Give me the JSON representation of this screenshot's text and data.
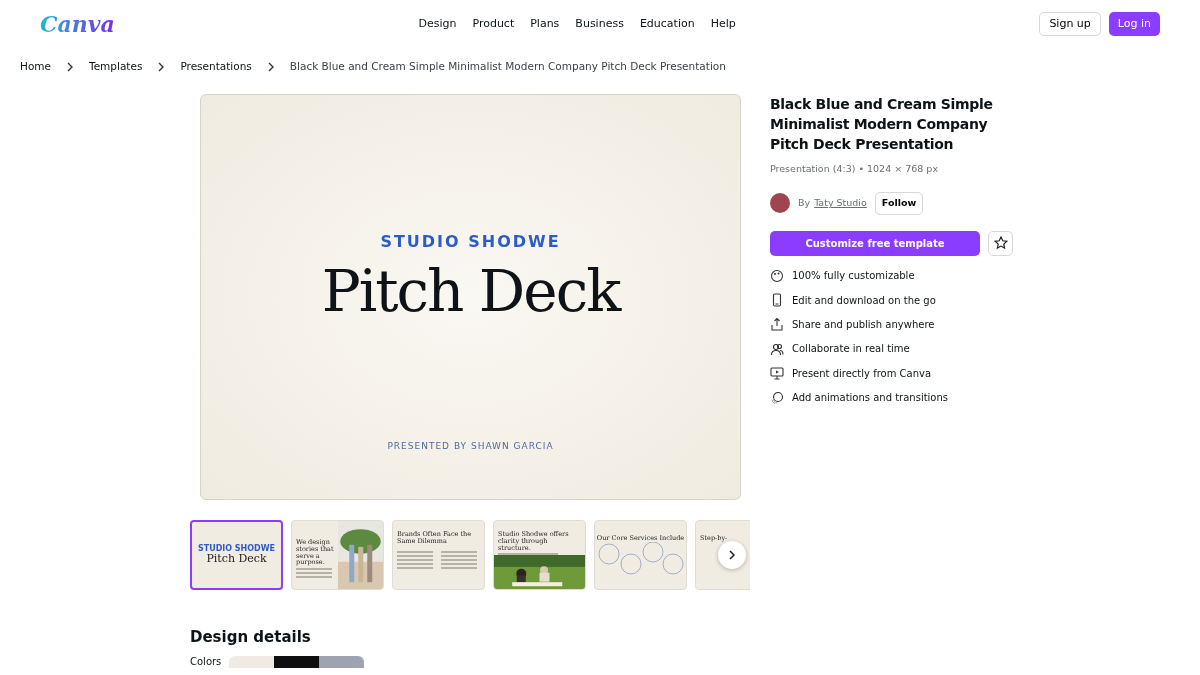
{
  "header": {
    "logo": "Canva",
    "nav": [
      "Design",
      "Product",
      "Plans",
      "Business",
      "Education",
      "Help"
    ],
    "signup": "Sign up",
    "login": "Log in"
  },
  "breadcrumb": [
    "Home",
    "Templates",
    "Presentations",
    "Black Blue and Cream Simple Minimalist Modern Company Pitch Deck Presentation"
  ],
  "preview": {
    "kicker": "STUDIO SHODWE",
    "title": "Pitch Deck",
    "footer": "PRESENTED BY SHAWN GARCIA"
  },
  "thumbnails": [
    {
      "kind": "cover",
      "kicker": "STUDIO SHODWE",
      "title": "Pitch Deck",
      "selected": true
    },
    {
      "kind": "photo-right",
      "title": "We design stories that serve a purpose.",
      "selected": false
    },
    {
      "kind": "grid",
      "title": "Brands Often Face the Same Dilemma",
      "selected": false
    },
    {
      "kind": "photo-bottom",
      "title": "Studio Shodwe offers clarity through structure.",
      "selected": false
    },
    {
      "kind": "circles",
      "title": "Our Core Services Include",
      "selected": false
    },
    {
      "kind": "partial",
      "title": "Step-by-",
      "selected": false
    }
  ],
  "details": {
    "title": "Black Blue and Cream Simple Minimalist Modern Company Pitch Deck Presentation",
    "meta": "Presentation (4:3) • 1024 × 768 px",
    "by": "By",
    "author": "Taty Studio",
    "follow": "Follow",
    "cta": "Customize free template",
    "features": [
      {
        "kind": "palette",
        "text": "100% fully customizable"
      },
      {
        "kind": "phone",
        "text": "Edit and download on the go"
      },
      {
        "kind": "share",
        "text": "Share and publish anywhere"
      },
      {
        "kind": "people",
        "text": "Collaborate in real time"
      },
      {
        "kind": "present",
        "text": "Present directly from Canva"
      },
      {
        "kind": "animate",
        "text": "Add animations and transitions"
      }
    ]
  },
  "design_details": {
    "heading": "Design details",
    "colors_label": "Colors",
    "colors": [
      {
        "color": "#efebe2"
      },
      {
        "color": "#0f0f0f"
      },
      {
        "color": "#9ea3b2"
      }
    ]
  }
}
